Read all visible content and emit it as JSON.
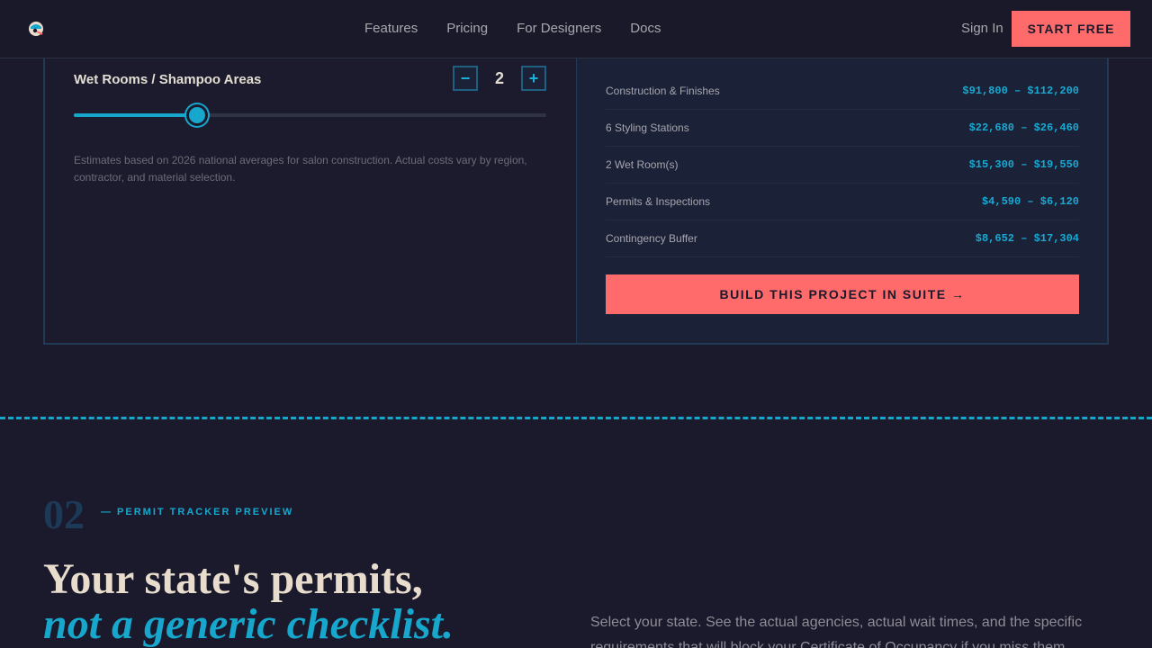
{
  "nav": {
    "links": [
      "Features",
      "Pricing",
      "For Designers",
      "Docs"
    ],
    "signin": "Sign In",
    "start": "START FREE"
  },
  "calculator": {
    "wet_rooms_label": "Wet Rooms / Shampoo Areas",
    "wet_rooms_value": "2",
    "slider_fraction": 0.26,
    "estimate_note": "Estimates based on 2026 national averages for salon construction. Actual costs vary by region, contractor, and material selection.",
    "costs": [
      {
        "label": "Construction & Finishes",
        "value": "$91,800 – $112,200"
      },
      {
        "label": "6 Styling Stations",
        "value": "$22,680 – $26,460"
      },
      {
        "label": "2 Wet Room(s)",
        "value": "$15,300 – $19,550"
      },
      {
        "label": "Permits & Inspections",
        "value": "$4,590 – $6,120"
      },
      {
        "label": "Contingency Buffer",
        "value": "$8,652 – $17,304"
      }
    ],
    "build_button": "BUILD THIS PROJECT IN SUITE →"
  },
  "section": {
    "number": "02",
    "tag": "— PERMIT TRACKER PREVIEW",
    "headline_line1": "Your state's permits,",
    "headline_line2": "not a generic checklist.",
    "description": "Select your state. See the actual agencies, actual wait times, and the specific requirements that will block your Certificate of Occupancy if you miss them."
  },
  "colors": {
    "background": "#1b1a2c",
    "accent": "#17a7cc",
    "coral": "#ff6b6b",
    "cream": "#e8dccd"
  },
  "icons": {
    "logo": "logo-icon",
    "stepper_minus": "minus-icon",
    "stepper_plus": "plus-icon"
  }
}
